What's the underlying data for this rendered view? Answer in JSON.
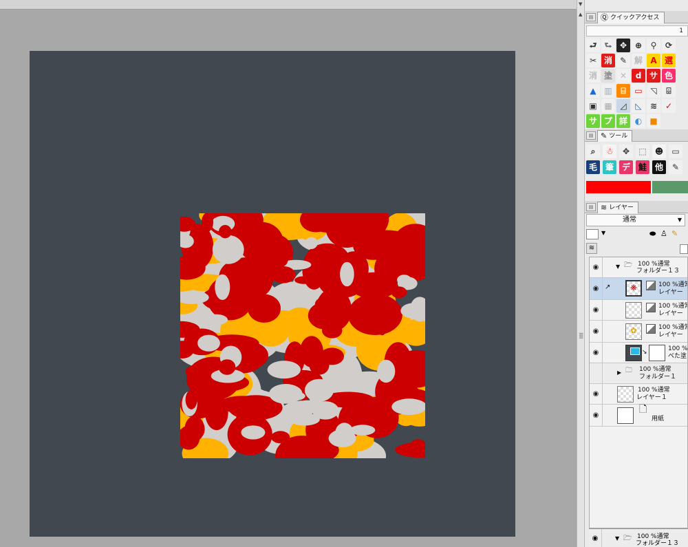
{
  "quick_access": {
    "tab_label": "クイックアクセス",
    "number": "1"
  },
  "icon_rows": [
    [
      {
        "g": "⮐",
        "bg": "#f0f0f0",
        "fg": "#333"
      },
      {
        "g": "⮑",
        "bg": "#f0f0f0",
        "fg": "#666"
      },
      {
        "g": "✥",
        "bg": "#222",
        "fg": "#fff"
      },
      {
        "g": "⊕",
        "bg": "#f0f0f0",
        "fg": "#222"
      },
      {
        "g": "⚲",
        "bg": "#f0f0f0",
        "fg": "#333"
      },
      {
        "g": "⟳",
        "bg": "#f0f0f0",
        "fg": "#333"
      },
      {
        "g": "✂",
        "bg": "#f0f0f0",
        "fg": "#333"
      }
    ],
    [
      {
        "g": "消",
        "bg": "#e21a1a",
        "fg": "#fff"
      },
      {
        "g": "✎",
        "bg": "#f0f0f0",
        "fg": "#333"
      },
      {
        "g": "解",
        "bg": "#f0f0f0",
        "fg": "#bbb"
      },
      {
        "g": "A",
        "bg": "#ffd400",
        "fg": "#e00"
      },
      {
        "g": "選",
        "bg": "#ffd400",
        "fg": "#e00"
      },
      {
        "g": "消",
        "bg": "#f0f0f0",
        "fg": "#bbb"
      },
      {
        "g": "塗",
        "bg": "#e0e0e0",
        "fg": "#888"
      }
    ],
    [
      {
        "g": "✕",
        "bg": "#f0f0f0",
        "fg": "#bbb"
      },
      {
        "g": "d",
        "bg": "#e21a1a",
        "fg": "#fff"
      },
      {
        "g": "サ",
        "bg": "#e21a1a",
        "fg": "#fff"
      },
      {
        "g": "色",
        "bg": "#ff2d6e",
        "fg": "#fff"
      },
      {
        "g": "▲",
        "bg": "#f0f0f0",
        "fg": "#1a6ad4"
      },
      {
        "g": "▥",
        "bg": "#f0f0f0",
        "fg": "#9ab"
      },
      {
        "g": "⌸",
        "bg": "#ff8a00",
        "fg": "#fff"
      }
    ],
    [
      {
        "g": "▭",
        "bg": "#f0f0f0",
        "fg": "#e00"
      },
      {
        "g": "◹",
        "bg": "#f0f0f0",
        "fg": "#333"
      },
      {
        "g": "⌹",
        "bg": "#f0f0f0",
        "fg": "#333"
      },
      {
        "g": "▣",
        "bg": "#f0f0f0",
        "fg": "#333"
      },
      {
        "g": "▦",
        "bg": "#f0f0f0",
        "fg": "#aaa"
      },
      {
        "g": "◿",
        "bg": "#c9d7e6",
        "fg": "#333"
      },
      {
        "g": "◺",
        "bg": "#f0f0f0",
        "fg": "#1a6ad4"
      }
    ],
    [
      {
        "g": "≋",
        "bg": "#f0f0f0",
        "fg": "#333"
      },
      {
        "g": "✓",
        "bg": "#f0f0f0",
        "fg": "#e00"
      },
      {
        "g": "サ",
        "bg": "#6fd43a",
        "fg": "#fff"
      },
      {
        "g": "プ",
        "bg": "#6fd43a",
        "fg": "#fff"
      },
      {
        "g": "詳",
        "bg": "#6fd43a",
        "fg": "#fff"
      },
      {
        "g": "◐",
        "bg": "#f0f0f0",
        "fg": "#3a8ee0"
      },
      {
        "g": "■",
        "bg": "#f0f0f0",
        "fg": "#e80"
      }
    ]
  ],
  "tool_panel": {
    "tab_label": "ツール"
  },
  "tool_rows": [
    [
      {
        "g": "⌕",
        "bg": "#f0f0f0",
        "fg": "#333"
      },
      {
        "g": "☃",
        "bg": "#f4f4f4",
        "fg": "#e00"
      },
      {
        "g": "✥",
        "bg": "#f0f0f0",
        "fg": "#333"
      },
      {
        "g": "⬚",
        "bg": "#f0f0f0",
        "fg": "#555"
      },
      {
        "g": "☻",
        "bg": "#f4f4f4",
        "fg": "#222"
      },
      {
        "g": "▭",
        "bg": "#f0f0f0",
        "fg": "#333"
      }
    ],
    [
      {
        "g": "毛",
        "bg": "#1b3f7a",
        "fg": "#fff"
      },
      {
        "g": "筆",
        "bg": "#2ec4c4",
        "fg": "#fff"
      },
      {
        "g": "デ",
        "bg": "#e8386b",
        "fg": "#fff"
      },
      {
        "g": "鮭",
        "bg": "#e8386b",
        "fg": "#111"
      },
      {
        "g": "他",
        "bg": "#111",
        "fg": "#fff"
      },
      {
        "g": "✎",
        "bg": "#f0f0f0",
        "fg": "#333"
      }
    ]
  ],
  "colors": {
    "main": "#ff0000",
    "sub": "#5a9a6a"
  },
  "layer_panel": {
    "tab_label": "レイヤー",
    "blend_mode": "通常"
  },
  "layers": [
    {
      "line1": "100 %通常",
      "line2": "フォルダー１３"
    },
    {
      "line1": "100 %通常",
      "line2": "レイヤー"
    },
    {
      "line1": "100 %通常",
      "line2": "レイヤー"
    },
    {
      "line1": "100 %通常",
      "line2": "レイヤー"
    },
    {
      "line1": "100 %",
      "line2": "べた塗"
    },
    {
      "line1": "100 %通常",
      "line2": "フォルダー１"
    },
    {
      "line1": "100 %通常",
      "line2": "レイヤー１"
    },
    {
      "line1": "",
      "line2": "用紙"
    }
  ],
  "bottom_layer": {
    "line1": "100 %通常",
    "line2": "フォルダー１３"
  },
  "artwork_colors": [
    "#cc0000",
    "#ffb300",
    "#d0cdca"
  ]
}
